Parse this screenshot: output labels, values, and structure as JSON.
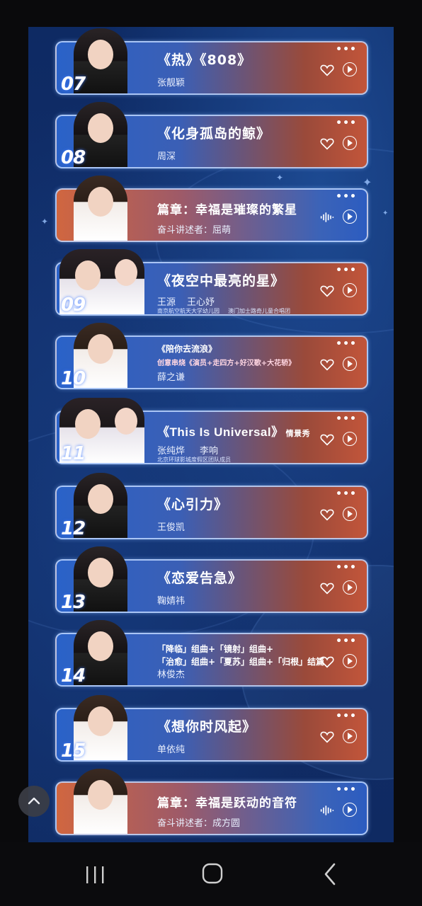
{
  "items": [
    {
      "number": "07",
      "title": "《热》《808》",
      "artist": "张靓颖",
      "type": "song"
    },
    {
      "number": "08",
      "title": "《化身孤岛的鲸》",
      "artist": "周深",
      "type": "song"
    },
    {
      "title": "篇章：幸福是璀璨的繁星",
      "artist": "奋斗讲述者：屈萌",
      "type": "chapter"
    },
    {
      "number": "09",
      "title": "《夜空中最亮的星》",
      "artist": "王源",
      "artist2": "王心妤",
      "note1": "南京航空航天大学幼儿园",
      "note2": "澳门加士路奇儿童合唱团",
      "type": "song"
    },
    {
      "number": "10",
      "title": "《陪你去流浪》",
      "subtitle": "创意串烧《演员+走四方+好汉歌+大花轿》",
      "artist": "薛之谦",
      "type": "song"
    },
    {
      "number": "11",
      "title": "《This Is Universal》",
      "title_suffix": "情景秀",
      "artist": "张纯烨",
      "artist2": "李响",
      "note1": "北京环球影城度假区团队成员",
      "type": "song"
    },
    {
      "number": "12",
      "title": "《心引力》",
      "artist": "王俊凯",
      "type": "song"
    },
    {
      "number": "13",
      "title": "《恋爱告急》",
      "artist": "鞠婧祎",
      "type": "song"
    },
    {
      "number": "14",
      "title": "「降临」组曲+「镜射」组曲+",
      "subtitle": "「治愈」组曲+「夏苏」组曲+「归根」结篇",
      "artist": "林俊杰",
      "type": "song"
    },
    {
      "number": "15",
      "title": "《想你时风起》",
      "artist": "单依纯",
      "type": "song"
    },
    {
      "title": "篇章：幸福是跃动的音符",
      "artist": "奋斗讲述者：成方圆",
      "type": "chapter"
    }
  ],
  "icons": {
    "more": "more-dots-icon",
    "favorite": "heart-icon",
    "play": "play-icon",
    "audio": "audio-wave-icon",
    "scroll_top": "chevron-up-icon",
    "nav_recents": "recents-icon",
    "nav_home": "home-icon",
    "nav_back": "back-icon"
  },
  "colors": {
    "panel": "#0e2a63",
    "accent": "#c2553a",
    "card_border": "#bed7ff"
  }
}
